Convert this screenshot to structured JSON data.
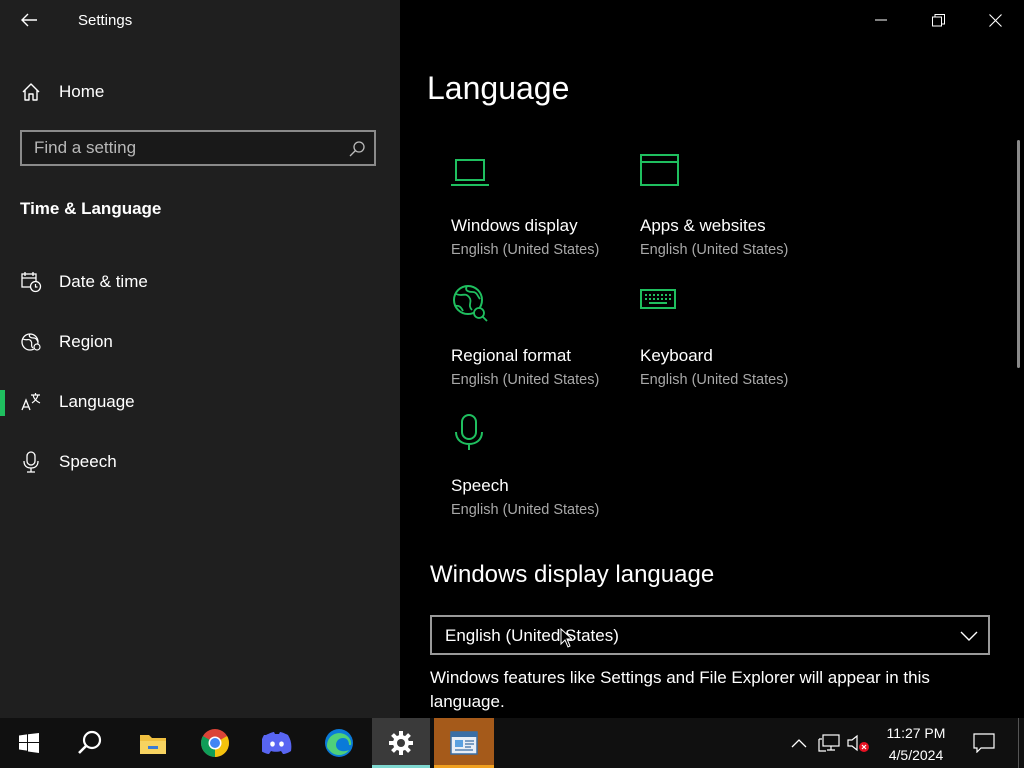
{
  "window": {
    "title": "Settings"
  },
  "sidebar": {
    "home_label": "Home",
    "search_placeholder": "Find a setting",
    "section": "Time & Language",
    "items": [
      {
        "label": "Date & time"
      },
      {
        "label": "Region"
      },
      {
        "label": "Language",
        "active": true
      },
      {
        "label": "Speech"
      }
    ]
  },
  "main": {
    "title": "Language",
    "tiles": [
      {
        "label": "Windows display",
        "value": "English (United States)"
      },
      {
        "label": "Apps & websites",
        "value": "English (United States)"
      },
      {
        "label": "Regional format",
        "value": "English (United States)"
      },
      {
        "label": "Keyboard",
        "value": "English (United States)"
      },
      {
        "label": "Speech",
        "value": "English (United States)"
      }
    ],
    "display_language": {
      "heading": "Windows display language",
      "selected": "English (United States)",
      "description": "Windows features like Settings and File Explorer will appear in this language."
    }
  },
  "taskbar": {
    "time": "11:27 PM",
    "date": "4/5/2024"
  },
  "colors": {
    "accent": "#1fbf5f",
    "sidebar_bg": "#1f1f1f",
    "content_bg": "#000000",
    "taskbar_bg": "#101010"
  }
}
